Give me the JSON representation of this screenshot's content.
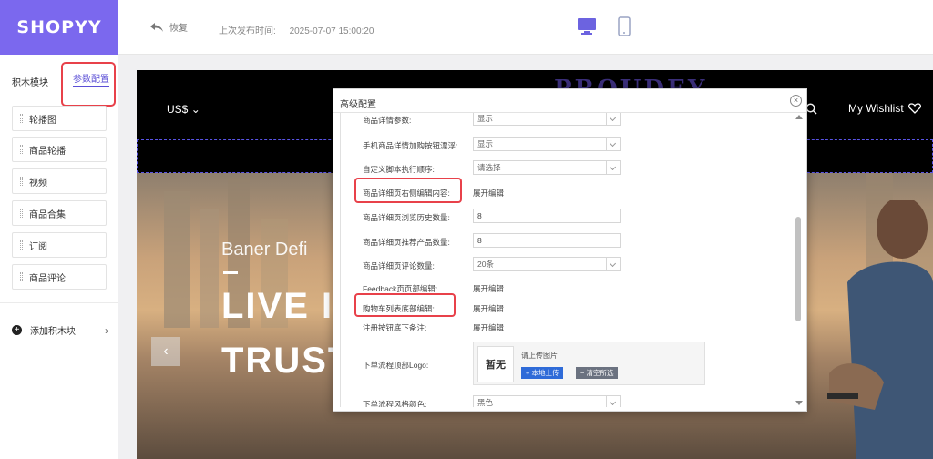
{
  "header": {
    "logo": "SHOPYY",
    "undo_label": "恢复",
    "publish_label": "上次发布时间:",
    "publish_time": "2025-07-07 15:00:20",
    "accent_color": "#7b68ee"
  },
  "sidebar": {
    "tab_blocks": "积木模块",
    "tab_params": "参数配置",
    "items": [
      {
        "label": "轮播图"
      },
      {
        "label": "商品轮播"
      },
      {
        "label": "视频"
      },
      {
        "label": "商品合集"
      },
      {
        "label": "订阅"
      },
      {
        "label": "商品评论"
      }
    ],
    "add_block": "添加积木块"
  },
  "preview": {
    "currency": "US$",
    "brand": "PROUDEY",
    "search_label": "h",
    "wishlist": "My Wishlist",
    "hero_sub": "Baner Defi",
    "hero_title1": "LIVE I",
    "hero_title2": "TRUST"
  },
  "modal": {
    "title": "高级配置",
    "rows": [
      {
        "label": "商品详情参数:",
        "type": "select",
        "value": "显示"
      },
      {
        "label": "手机商品详情加购按钮漂浮:",
        "type": "select",
        "value": "显示"
      },
      {
        "label": "自定义脚本执行顺序:",
        "type": "select",
        "value": "请选择"
      },
      {
        "label": "商品详细页右侧编辑内容:",
        "type": "link",
        "value": "展开编辑"
      },
      {
        "label": "商品详细页浏览历史数量:",
        "type": "input",
        "value": "8"
      },
      {
        "label": "商品详细页推荐产品数量:",
        "type": "input",
        "value": "8"
      },
      {
        "label": "商品详细页评论数量:",
        "type": "select",
        "value": "20条"
      },
      {
        "label": "Feedback页页部编辑:",
        "type": "link",
        "value": "展开编辑"
      },
      {
        "label": "购物车列表底部编辑:",
        "type": "link",
        "value": "展开编辑"
      },
      {
        "label": "注册按钮底下备注:",
        "type": "link",
        "value": "展开编辑"
      },
      {
        "label": "下单流程顶部Logo:",
        "type": "upload"
      },
      {
        "label": "下单流程风格颜色:",
        "type": "select",
        "value": "黑色"
      }
    ],
    "logo_upload": {
      "thumb_text": "暂无",
      "hint": "请上传图片",
      "upload_btn": "+ 本地上传",
      "clear_btn": "− 清空所选"
    }
  }
}
